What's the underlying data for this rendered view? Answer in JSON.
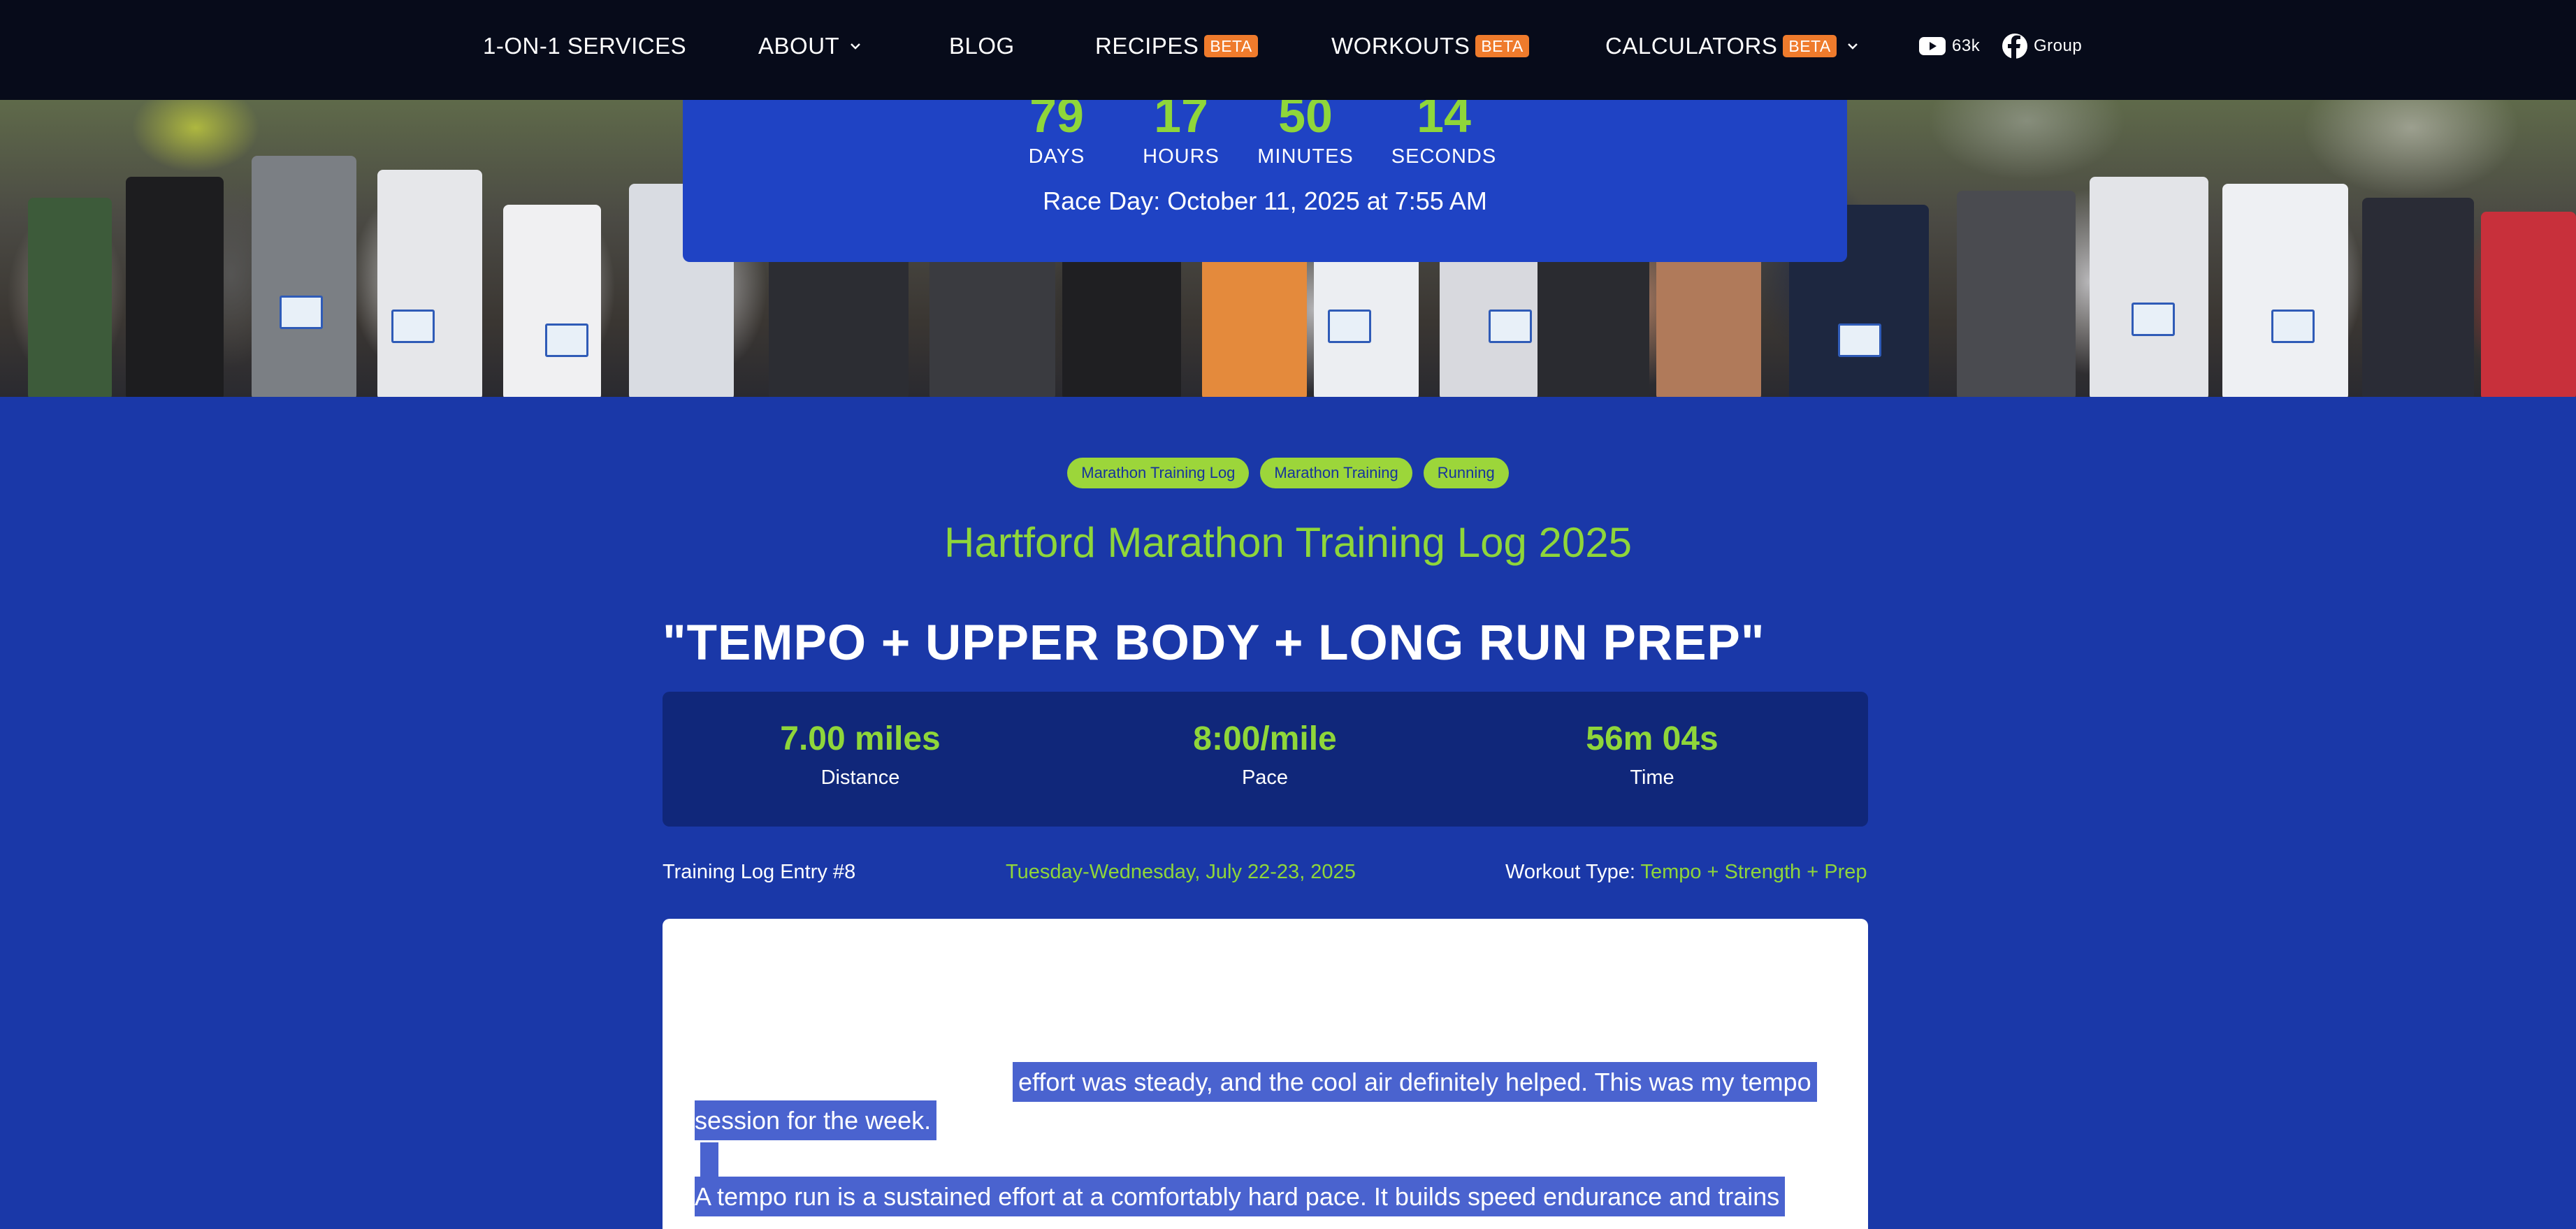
{
  "nav": {
    "items": [
      {
        "label": "1-ON-1 SERVICES"
      },
      {
        "label": "ABOUT"
      },
      {
        "label": "BLOG"
      },
      {
        "label": "RECIPES",
        "badge": "BETA"
      },
      {
        "label": "WORKOUTS",
        "badge": "BETA"
      },
      {
        "label": "CALCULATORS",
        "badge": "BETA"
      }
    ],
    "youtube": {
      "icon": "youtube-icon",
      "count": "63k"
    },
    "facebook": {
      "icon": "facebook-icon",
      "label": "Group"
    }
  },
  "countdown": {
    "days": "79",
    "days_label": "DAYS",
    "hours": "17",
    "hours_label": "HOURS",
    "minutes": "50",
    "minutes_label": "MINUTES",
    "seconds": "14",
    "seconds_label": "SECONDS",
    "race_day": "Race Day: October 11, 2025 at 7:55 AM"
  },
  "tags": [
    "Marathon Training Log",
    "Marathon Training",
    "Running"
  ],
  "log_title": "Hartford Marathon Training Log 2025",
  "workout_title": "\"TEMPO + UPPER BODY + LONG RUN PREP\"",
  "stats": {
    "distance": {
      "value": "7.00 miles",
      "label": "Distance"
    },
    "pace": {
      "value": "8:00/mile",
      "label": "Pace"
    },
    "time": {
      "value": "56m 04s",
      "label": "Time"
    }
  },
  "meta": {
    "entry": "Training Log Entry #8",
    "date": "Tuesday-Wednesday, July 22-23, 2025",
    "type_label": "Workout Type: ",
    "type_value": "Tempo + Strength + Prep"
  },
  "content": {
    "p1_line1": "effort was steady, and the cool air definitely helped. This was my tempo",
    "p1_line2": "session for the week.",
    "p2_line1": "A tempo run is a sustained effort at a comfortably hard pace. It builds speed endurance and trains"
  },
  "colors": {
    "page_bg": "#1a38a8",
    "nav_bg": "#070b1a",
    "accent_green": "#8fd63a",
    "beta_orange": "#ef7b2c",
    "stats_bg": "#10277a",
    "selection": "#4a63cf"
  }
}
